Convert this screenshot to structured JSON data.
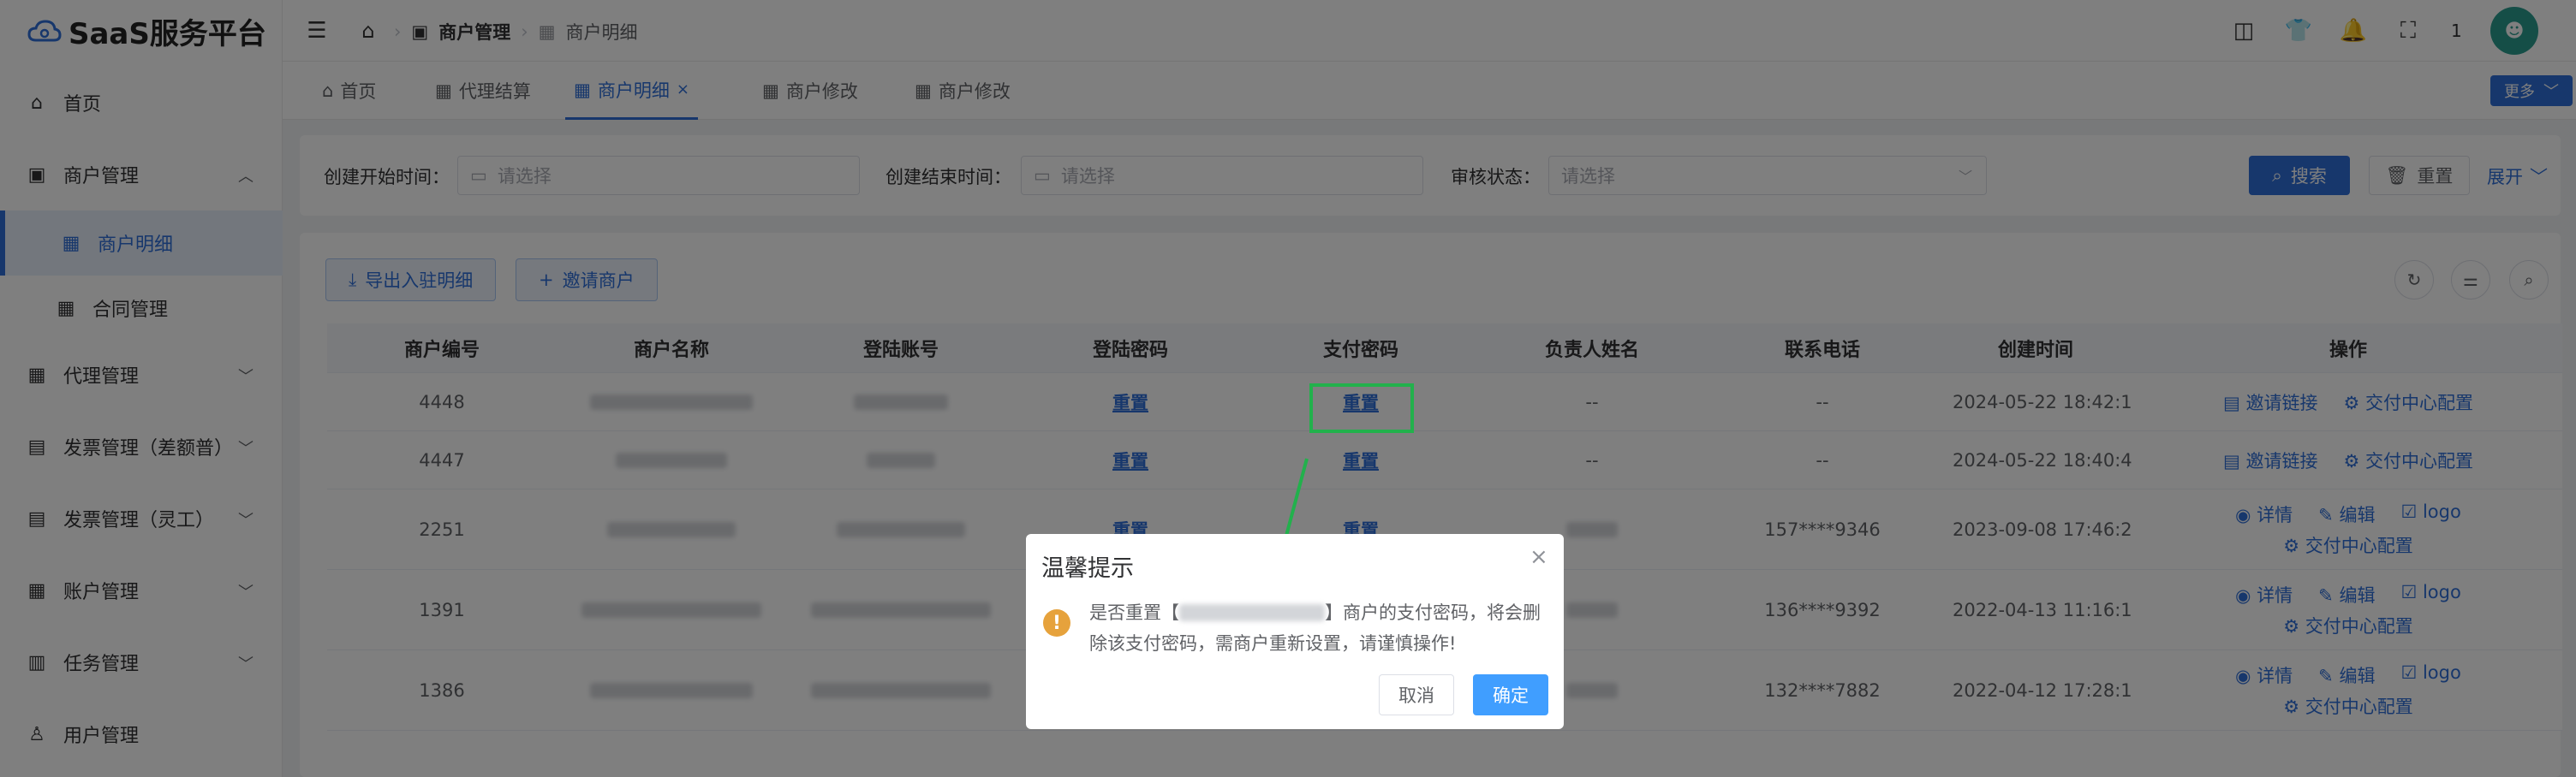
{
  "app": {
    "title": "SaaS服务平台",
    "brand_color": "#2f6fd8"
  },
  "sidebar": {
    "items": [
      {
        "label": "首页",
        "icon": "home-icon"
      },
      {
        "label": "商户管理",
        "icon": "shop-icon",
        "expanded": true
      },
      {
        "label": "商户明细",
        "icon": "grid-icon",
        "active": true
      },
      {
        "label": "合同管理",
        "icon": "grid-icon"
      },
      {
        "label": "代理管理",
        "icon": "grid-icon"
      },
      {
        "label": "发票管理（差额普）",
        "icon": "invoice-icon"
      },
      {
        "label": "发票管理（灵工）",
        "icon": "invoice-icon"
      },
      {
        "label": "账户管理",
        "icon": "grid-icon"
      },
      {
        "label": "任务管理",
        "icon": "task-icon"
      },
      {
        "label": "用户管理",
        "icon": "user-icon"
      }
    ]
  },
  "header": {
    "breadcrumb": [
      "商户管理",
      "商户明细"
    ],
    "badge_count": "1"
  },
  "tabs": {
    "items": [
      "首页",
      "代理结算",
      "商户明细",
      "商户修改",
      "商户修改"
    ],
    "more": "更多"
  },
  "filter": {
    "start_label": "创建开始时间：",
    "start_placeholder": "请选择",
    "end_label": "创建结束时间：",
    "end_placeholder": "请选择",
    "status_label": "审核状态：",
    "status_placeholder": "请选择",
    "search": "搜索",
    "reset": "重置",
    "expand": "展开"
  },
  "toolbar": {
    "export": "导出入驻明细",
    "invite": "邀请商户"
  },
  "table": {
    "columns": [
      "商户编号",
      "商户名称",
      "登陆账号",
      "登陆密码",
      "支付密码",
      "负责人姓名",
      "联系电话",
      "创建时间",
      "操作"
    ],
    "rows": [
      {
        "id": "4448",
        "login_pwd": "重置",
        "pay_pwd": "重置",
        "owner": "--",
        "phone": "--",
        "created": "2024-05-22 18:42:1"
      },
      {
        "id": "4447",
        "login_pwd": "重置",
        "pay_pwd": "重置",
        "owner": "--",
        "phone": "--",
        "created": "2024-05-22 18:40:4"
      },
      {
        "id": "2251",
        "login_pwd": "重置",
        "pay_pwd": "重置",
        "owner": "",
        "phone": "157****9346",
        "created": "2023-09-08 17:46:2"
      },
      {
        "id": "1391",
        "login_pwd": "",
        "pay_pwd": "",
        "owner": "",
        "phone": "136****9392",
        "created": "2022-04-13 11:16:1"
      },
      {
        "id": "1386",
        "login_pwd": "",
        "pay_pwd": "",
        "owner": "",
        "phone": "132****7882",
        "created": "2022-04-12 17:28:1"
      }
    ],
    "ops": {
      "invite_link": "邀请链接",
      "delivery_config": "交付中心配置",
      "detail": "详情",
      "edit": "编辑",
      "logo": "logo"
    }
  },
  "dialog": {
    "title": "温馨提示",
    "message_prefix": "是否重置【",
    "message_suffix": "】商户的支付密码，将会删",
    "message_line2": "除该支付密码，需商户重新设置，请谨慎操作!",
    "cancel": "取消",
    "confirm": "确定"
  },
  "annotation_color": "#22b14c"
}
